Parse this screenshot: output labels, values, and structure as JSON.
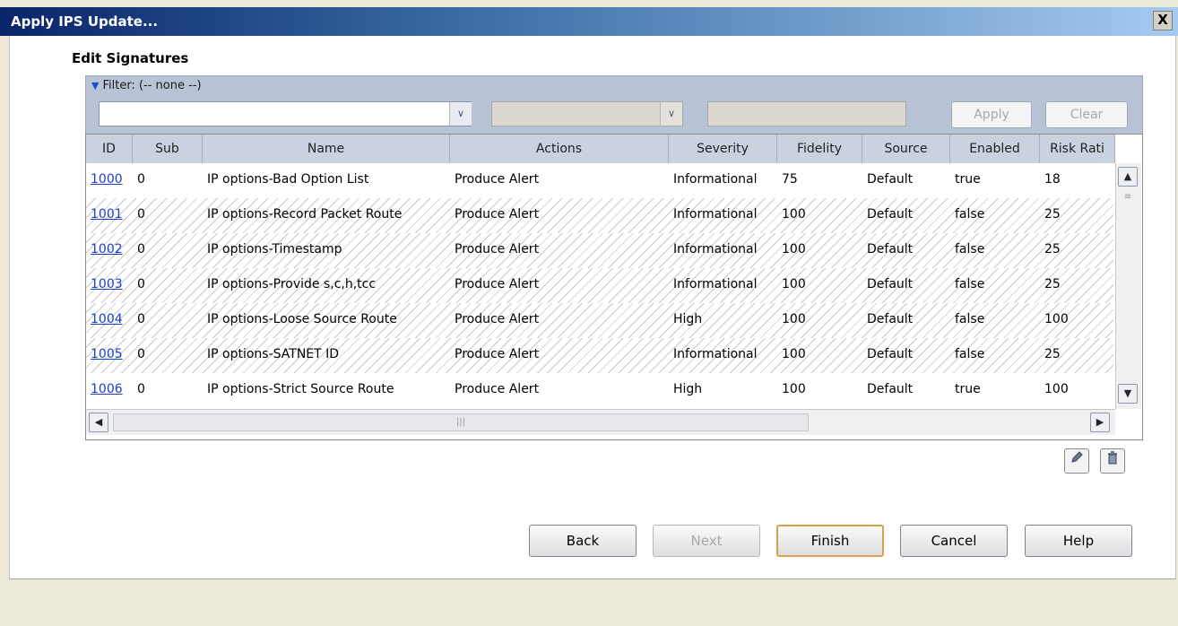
{
  "window": {
    "title": "Apply IPS Update...",
    "close_label": "X"
  },
  "section": {
    "title": "Edit Signatures"
  },
  "filter": {
    "label": "Filter: (-- none --)",
    "field_value": "",
    "condition_value": "",
    "text_value": "",
    "apply_label": "Apply",
    "clear_label": "Clear"
  },
  "table": {
    "columns": [
      "ID",
      "Sub",
      "Name",
      "Actions",
      "Severity",
      "Fidelity",
      "Source",
      "Enabled",
      "Risk Rati"
    ],
    "rows": [
      {
        "id": "1000",
        "sub": "0",
        "name": "IP options-Bad Option List",
        "actions": "Produce Alert",
        "severity": "Informational",
        "fidelity": "75",
        "source": "Default",
        "enabled": "true",
        "risk": "18",
        "striped": false
      },
      {
        "id": "1001",
        "sub": "0",
        "name": "IP options-Record Packet Route",
        "actions": "Produce Alert",
        "severity": "Informational",
        "fidelity": "100",
        "source": "Default",
        "enabled": "false",
        "risk": "25",
        "striped": true
      },
      {
        "id": "1002",
        "sub": "0",
        "name": "IP options-Timestamp",
        "actions": "Produce Alert",
        "severity": "Informational",
        "fidelity": "100",
        "source": "Default",
        "enabled": "false",
        "risk": "25",
        "striped": true
      },
      {
        "id": "1003",
        "sub": "0",
        "name": "IP options-Provide s,c,h,tcc",
        "actions": "Produce Alert",
        "severity": "Informational",
        "fidelity": "100",
        "source": "Default",
        "enabled": "false",
        "risk": "25",
        "striped": true
      },
      {
        "id": "1004",
        "sub": "0",
        "name": "IP options-Loose Source Route",
        "actions": "Produce Alert",
        "severity": "High",
        "fidelity": "100",
        "source": "Default",
        "enabled": "false",
        "risk": "100",
        "striped": true
      },
      {
        "id": "1005",
        "sub": "0",
        "name": "IP options-SATNET ID",
        "actions": "Produce Alert",
        "severity": "Informational",
        "fidelity": "100",
        "source": "Default",
        "enabled": "false",
        "risk": "25",
        "striped": true
      },
      {
        "id": "1006",
        "sub": "0",
        "name": "IP options-Strict Source Route",
        "actions": "Produce Alert",
        "severity": "High",
        "fidelity": "100",
        "source": "Default",
        "enabled": "true",
        "risk": "100",
        "striped": false
      }
    ]
  },
  "icons": {
    "edit": "pencil-icon",
    "delete": "trash-icon"
  },
  "buttons": {
    "back": "Back",
    "next": "Next",
    "finish": "Finish",
    "cancel": "Cancel",
    "help": "Help"
  },
  "colors": {
    "title_bar": "#0a246a",
    "link": "#1a3fc8",
    "default_button_border": "#d8a24a"
  }
}
